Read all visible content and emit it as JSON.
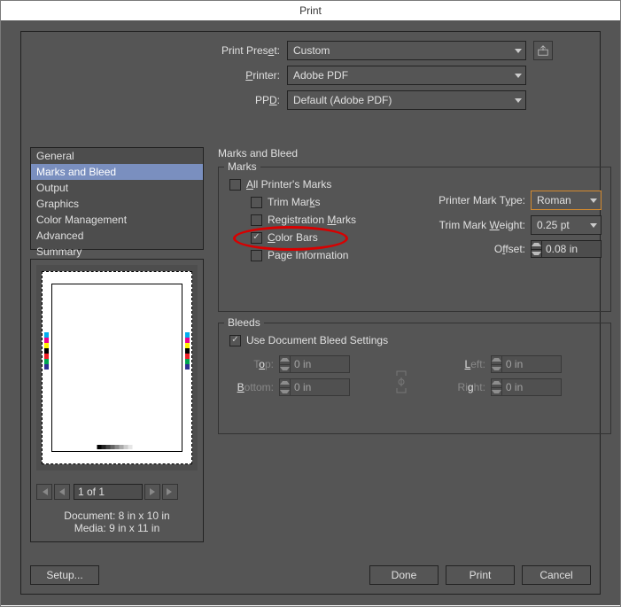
{
  "title": "Print",
  "header": {
    "preset": {
      "label": "Print Preset:",
      "value": "Custom",
      "accel": "e"
    },
    "printer": {
      "label": "Printer:",
      "value": "Adobe PDF",
      "accel": "P"
    },
    "ppd": {
      "label": "PPD:",
      "value": "Default (Adobe PDF)",
      "accel": "D"
    }
  },
  "categories": [
    "General",
    "Marks and Bleed",
    "Output",
    "Graphics",
    "Color Management",
    "Advanced",
    "Summary"
  ],
  "selected_category": 1,
  "section_title": "Marks and Bleed",
  "marks": {
    "group_label": "Marks",
    "all": "All Printer's Marks",
    "trim": "Trim Marks",
    "registration": "Registration Marks",
    "color_bars": "Color Bars",
    "page_info": "Page Information",
    "checked": {
      "all": false,
      "trim": false,
      "registration": false,
      "color_bars": true,
      "page_info": false
    },
    "type_label": "Printer Mark Type:",
    "type_value": "Roman",
    "weight_label": "Trim Mark Weight:",
    "weight_value": "0.25 pt",
    "offset_label": "Offset:",
    "offset_value": "0.08 in"
  },
  "bleeds": {
    "group_label": "Bleeds",
    "use_doc": "Use Document Bleed Settings",
    "use_doc_checked": true,
    "top": {
      "label": "Top:",
      "value": "0 in"
    },
    "bottom": {
      "label": "Bottom:",
      "value": "0 in"
    },
    "left": {
      "label": "Left:",
      "value": "0 in"
    },
    "right": {
      "label": "Right:",
      "value": "0 in"
    }
  },
  "preview": {
    "page_indicator": "1 of 1",
    "document": "Document:  8 in x 10 in",
    "media": "Media:  9 in x 11 in",
    "color_bars": [
      "#00aeef",
      "#ec008c",
      "#fff200",
      "#000000",
      "#ed1c24",
      "#00a651",
      "#2e3192"
    ],
    "gray_strip": [
      "#000",
      "#222",
      "#444",
      "#666",
      "#888",
      "#aaa",
      "#ccc",
      "#e6e6e6",
      "#fff"
    ]
  },
  "buttons": {
    "setup": "Setup...",
    "done": "Done",
    "print": "Print",
    "cancel": "Cancel"
  }
}
